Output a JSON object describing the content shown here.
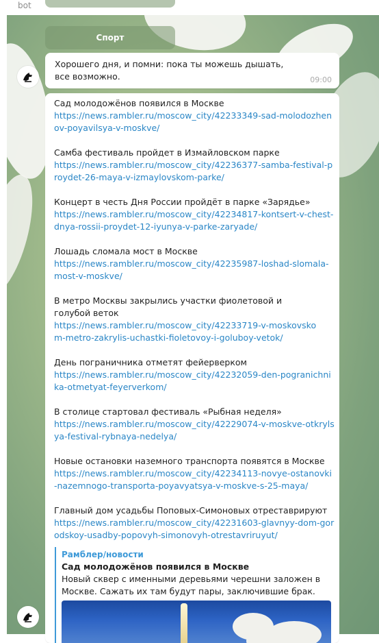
{
  "window": {
    "title": "bot"
  },
  "keyboard": {
    "sport_label": "Спорт"
  },
  "message1": {
    "text": "Хорошего дня, и помни: пока ты можешь дышать, все возможно.",
    "time": "09:00"
  },
  "news": [
    {
      "title": "Сад молодожёнов появился в Москве",
      "link": "https://news.rambler.ru/moscow_city/42233349-sad-molodozhenov-poyavilsya-v-moskve/"
    },
    {
      "title": "Самба фестиваль пройдет в Измайловском парке",
      "link": " https://news.rambler.ru/moscow_city/42236377-samba-festival-proydet-26-maya-v-izmaylovskom-parke/"
    },
    {
      "title": "Концерт в честь Дня России пройдёт в парке «Зарядье»",
      "link": "https://news.rambler.ru/moscow_city/42234817-kontsert-v-chest-dnya-rossii-proydet-12-iyunya-v-parke-zaryade/"
    },
    {
      "title": "Лошадь сломала мост в Москве",
      "link": "https://news.rambler.ru/moscow_city/42235987-loshad-slomala-most-v-moskve/"
    },
    {
      "title": "В метро Москвы закрылись участки фиолетовой и голубой веток",
      "link": " https://news.rambler.ru/moscow_city/42233719-v-moskovskom-metro-zakrylis-uchastki-fioletovoy-i-goluboy-vetok/"
    },
    {
      "title": "День пограничника отметят фейерверком",
      "link": "https://news.rambler.ru/moscow_city/42232059-den-pogranichnika-otmetyat-feyerverkom/"
    },
    {
      "title": "В столице стартовал фестиваль «Рыбная неделя»",
      "link": "https://news.rambler.ru/moscow_city/42229074-v-moskve-otkrylsya-festival-rybnaya-nedelya/"
    },
    {
      "title": "Новые остановки наземного транспорта появятся в Москве",
      "link": "https://news.rambler.ru/moscow_city/42234113-novye-ostanovki-nazemnogo-transporta-poyavyatsya-v-moskve-s-25-maya/"
    },
    {
      "title": "Главный дом усадьбы Поповых-Симоновых отреставрируют",
      "link": " https://news.rambler.ru/moscow_city/42231603-glavnyy-dom-gorodskoy-usadby-popovyh-simonovyh-otrestavriruyut/"
    }
  ],
  "preview": {
    "site": "Рамблер/новости",
    "title": "Сад молодожёнов появился в Москве",
    "description": "Новый сквер с именными деревьями черешни заложен в Москве. Сажать их там будут пары, заключившие брак."
  },
  "colors": {
    "link": "#2a86c6",
    "accent": "#3e9ad8"
  },
  "icons": {
    "avatar": "bot-avatar-icon"
  }
}
